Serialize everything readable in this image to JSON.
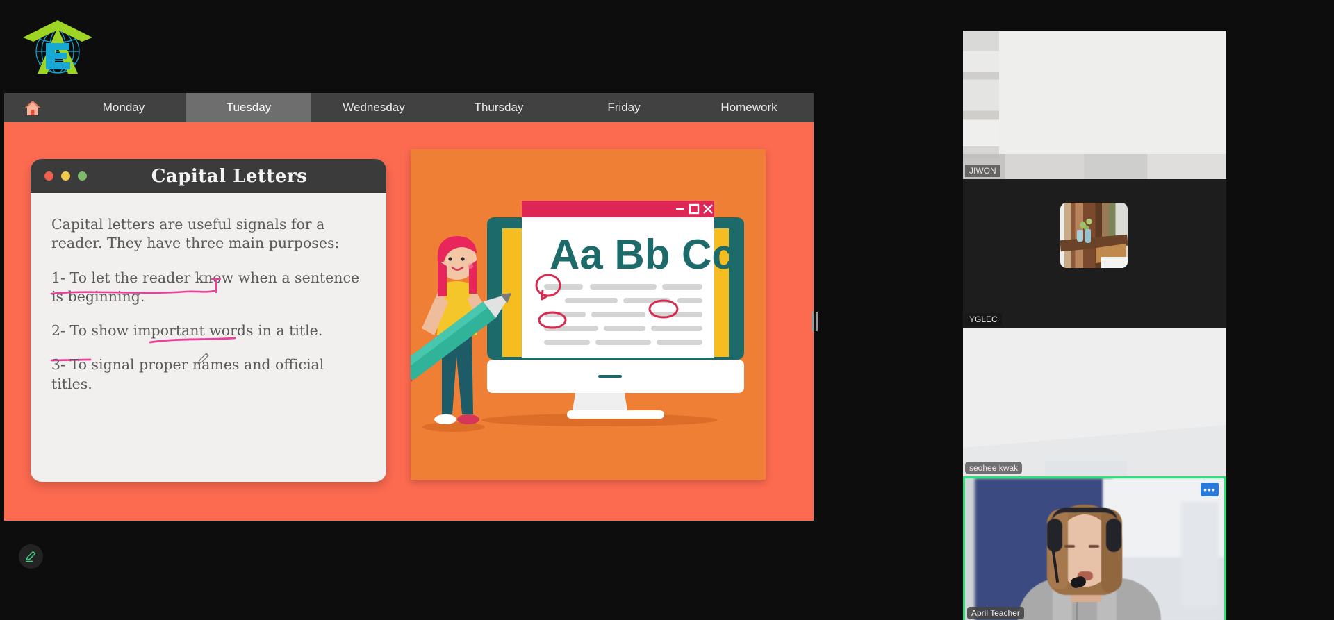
{
  "app": {
    "logo_alt": "academy-globe-logo"
  },
  "tabbar": {
    "home_icon": "home-icon",
    "tabs": [
      {
        "id": "monday",
        "label": "Monday",
        "active": false
      },
      {
        "id": "tuesday",
        "label": "Tuesday",
        "active": true
      },
      {
        "id": "wednesday",
        "label": "Wednesday",
        "active": false
      },
      {
        "id": "thursday",
        "label": "Thursday",
        "active": false
      },
      {
        "id": "friday",
        "label": "Friday",
        "active": false
      },
      {
        "id": "homework",
        "label": "Homework",
        "active": false
      }
    ]
  },
  "slide": {
    "background_color": "#fc6a50",
    "note_card": {
      "title": "Capital Letters",
      "window_dots": [
        "red",
        "yellow",
        "green"
      ],
      "paragraphs": [
        "Capital letters  are useful signals for a reader. They have three main purposes:",
        "1- To let the reader know when a sentence is beginning.",
        "2- To show important words in a title.",
        "3- To signal proper names and official titles."
      ],
      "annotation_color": "#ef3d9c",
      "annotations": [
        "underline-sentence-is-beginning",
        "vertical-tick-after-beginning",
        "underline-important",
        "underline-title"
      ],
      "cursor": "pencil-cursor"
    },
    "illustration": {
      "name": "capital-letters-illustration",
      "background_color": "#ef7f34",
      "monitor_letters": "Aa Bb Cc",
      "titlebar_color": "#dd2556",
      "window_controls": [
        "minimize",
        "maximize",
        "close"
      ],
      "screen_accent": "#f5bd1f",
      "bezel_color": "#1d6a6b",
      "pencil_color": "#31b39a",
      "circle_marks": 3
    },
    "drag_handle": "panel-resize-handle"
  },
  "toolbar": {
    "edit_label": "pencil-icon"
  },
  "rail": {
    "participants": [
      {
        "id": "jiwon",
        "name": "JIWON",
        "badge_style": "plain",
        "active_speaker": false,
        "has_menu": false
      },
      {
        "id": "yglec",
        "name": "YGLEC",
        "badge_style": "plain",
        "active_speaker": false,
        "has_menu": false
      },
      {
        "id": "seohee-kwak",
        "name": "seohee kwak",
        "badge_style": "pill",
        "active_speaker": false,
        "has_menu": false
      },
      {
        "id": "april-teacher",
        "name": "April Teacher",
        "badge_style": "solid",
        "active_speaker": true,
        "has_menu": true,
        "menu_label": "•••",
        "border_color": "#2fe07a"
      }
    ]
  }
}
